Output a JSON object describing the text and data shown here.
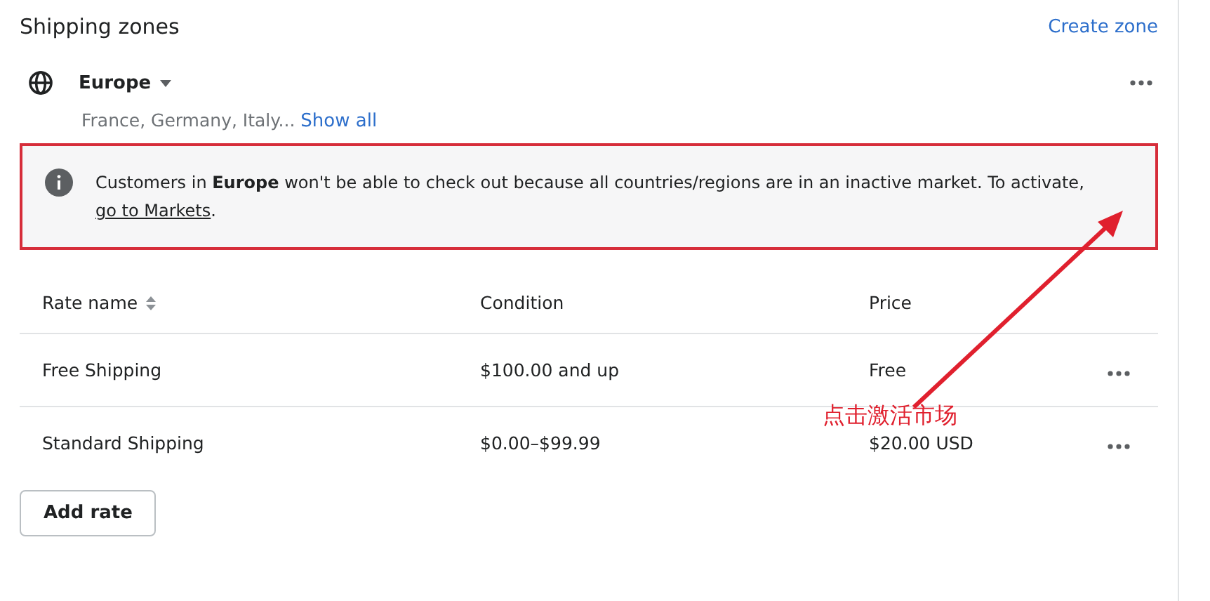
{
  "header": {
    "title": "Shipping zones",
    "action": "Create zone"
  },
  "zone": {
    "name": "Europe",
    "countries": "France, Germany, Italy...",
    "show_all": "Show all"
  },
  "notice": {
    "text": "Customers in **Europe** won't be able to check out because all countries/regions are in an inactive market. To activate, ",
    "link": "go to Markets",
    "end": ".",
    "highlighted": true
  },
  "table": {
    "columns": [
      {
        "label": "Rate name",
        "sortable": true
      },
      {
        "label": "Condition",
        "sortable": false
      },
      {
        "label": "Price",
        "sortable": false
      }
    ],
    "rows": [
      {
        "cells": [
          "Free Shipping",
          "$100.00 and up",
          "Free"
        ]
      },
      {
        "cells": [
          "Standard Shipping",
          "$0.00–$99.99",
          "$20.00 USD"
        ]
      }
    ]
  },
  "add_button": "Add rate",
  "annotation": {
    "label": "点击激活市场"
  }
}
